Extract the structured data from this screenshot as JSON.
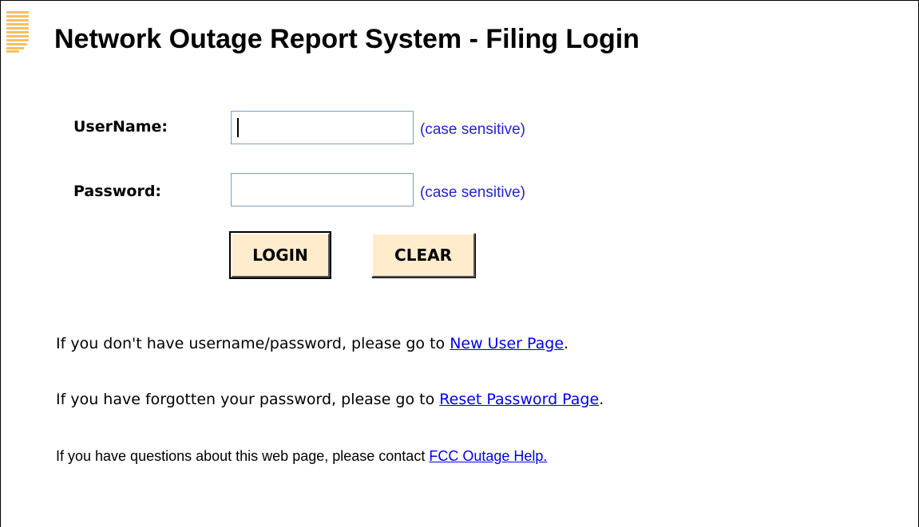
{
  "page": {
    "title": "Network Outage Report System - Filing Login"
  },
  "form": {
    "username_label": "UserName:",
    "username_value": "",
    "username_hint": "(case sensitive)",
    "password_label": "Password:",
    "password_value": "",
    "password_hint": "(case sensitive)",
    "login_label": "LOGIN",
    "clear_label": "CLEAR"
  },
  "info": {
    "line1_text": "If you don't have username/password, please go to ",
    "line1_link": "New User Page",
    "line1_suffix": ".",
    "line2_text": "If you have forgotten your password, please go to ",
    "line2_link": "Reset Password Page",
    "line2_suffix": ".",
    "line3_text": "If you have questions about this web page, please contact ",
    "line3_link": "FCC Outage Help."
  },
  "colors": {
    "button_bg": "#ffeccc",
    "hint_text": "#2323d8",
    "link": "#0000ee",
    "icon_stripe": "#f5c25b"
  }
}
